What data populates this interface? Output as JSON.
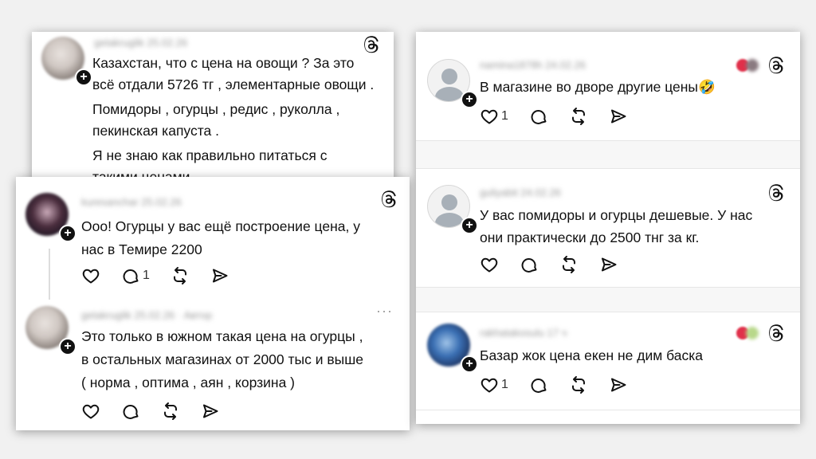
{
  "left_top": {
    "username": "getakruglik 25.02.26",
    "lines": [
      "Казахстан, что с цена на овощи ? За это",
      "всё отдали 5726 тг , элементарные овощи .",
      "Помидоры , огурцы , редис , руколла ,",
      "пекинская капуста .",
      "Я не знаю как правильно питаться с",
      "такими ценами"
    ]
  },
  "left_bottom": {
    "post1": {
      "username": "kuresanchar 25.02.26",
      "lines": [
        "Ооо! Огурцы у вас ещё построение цена, у",
        "нас в Темире 2200"
      ],
      "comment_count": "1"
    },
    "post2": {
      "username": "getakruglik 25.02.26 · Автор",
      "more": "···",
      "lines": [
        "Это только в южном такая цена на огурцы ,",
        "в остальных магазинах от 2000 тыс и выше",
        "( норма , оптима , аян , корзина )"
      ]
    }
  },
  "right_top": {
    "username": "namina1878h 24.02.26",
    "text": "В магазине во дворе другие цены🤣",
    "like_count": "1"
  },
  "right_mid": {
    "username": "guliyabit 24.02.26",
    "lines": [
      "У вас помидоры и огурцы дешевые. У нас",
      "они практически до 2500 тнг за кг."
    ]
  },
  "right_bottom": {
    "username": "rakhatakosulu 17 ч",
    "text": "Базар жок цена екен не дим баска",
    "like_count": "1"
  },
  "icons": {
    "heart": "heart-icon",
    "comment": "comment-icon",
    "repost": "repost-icon",
    "share": "share-icon",
    "threads": "threads-logo-icon",
    "plus": "follow-plus-icon"
  }
}
